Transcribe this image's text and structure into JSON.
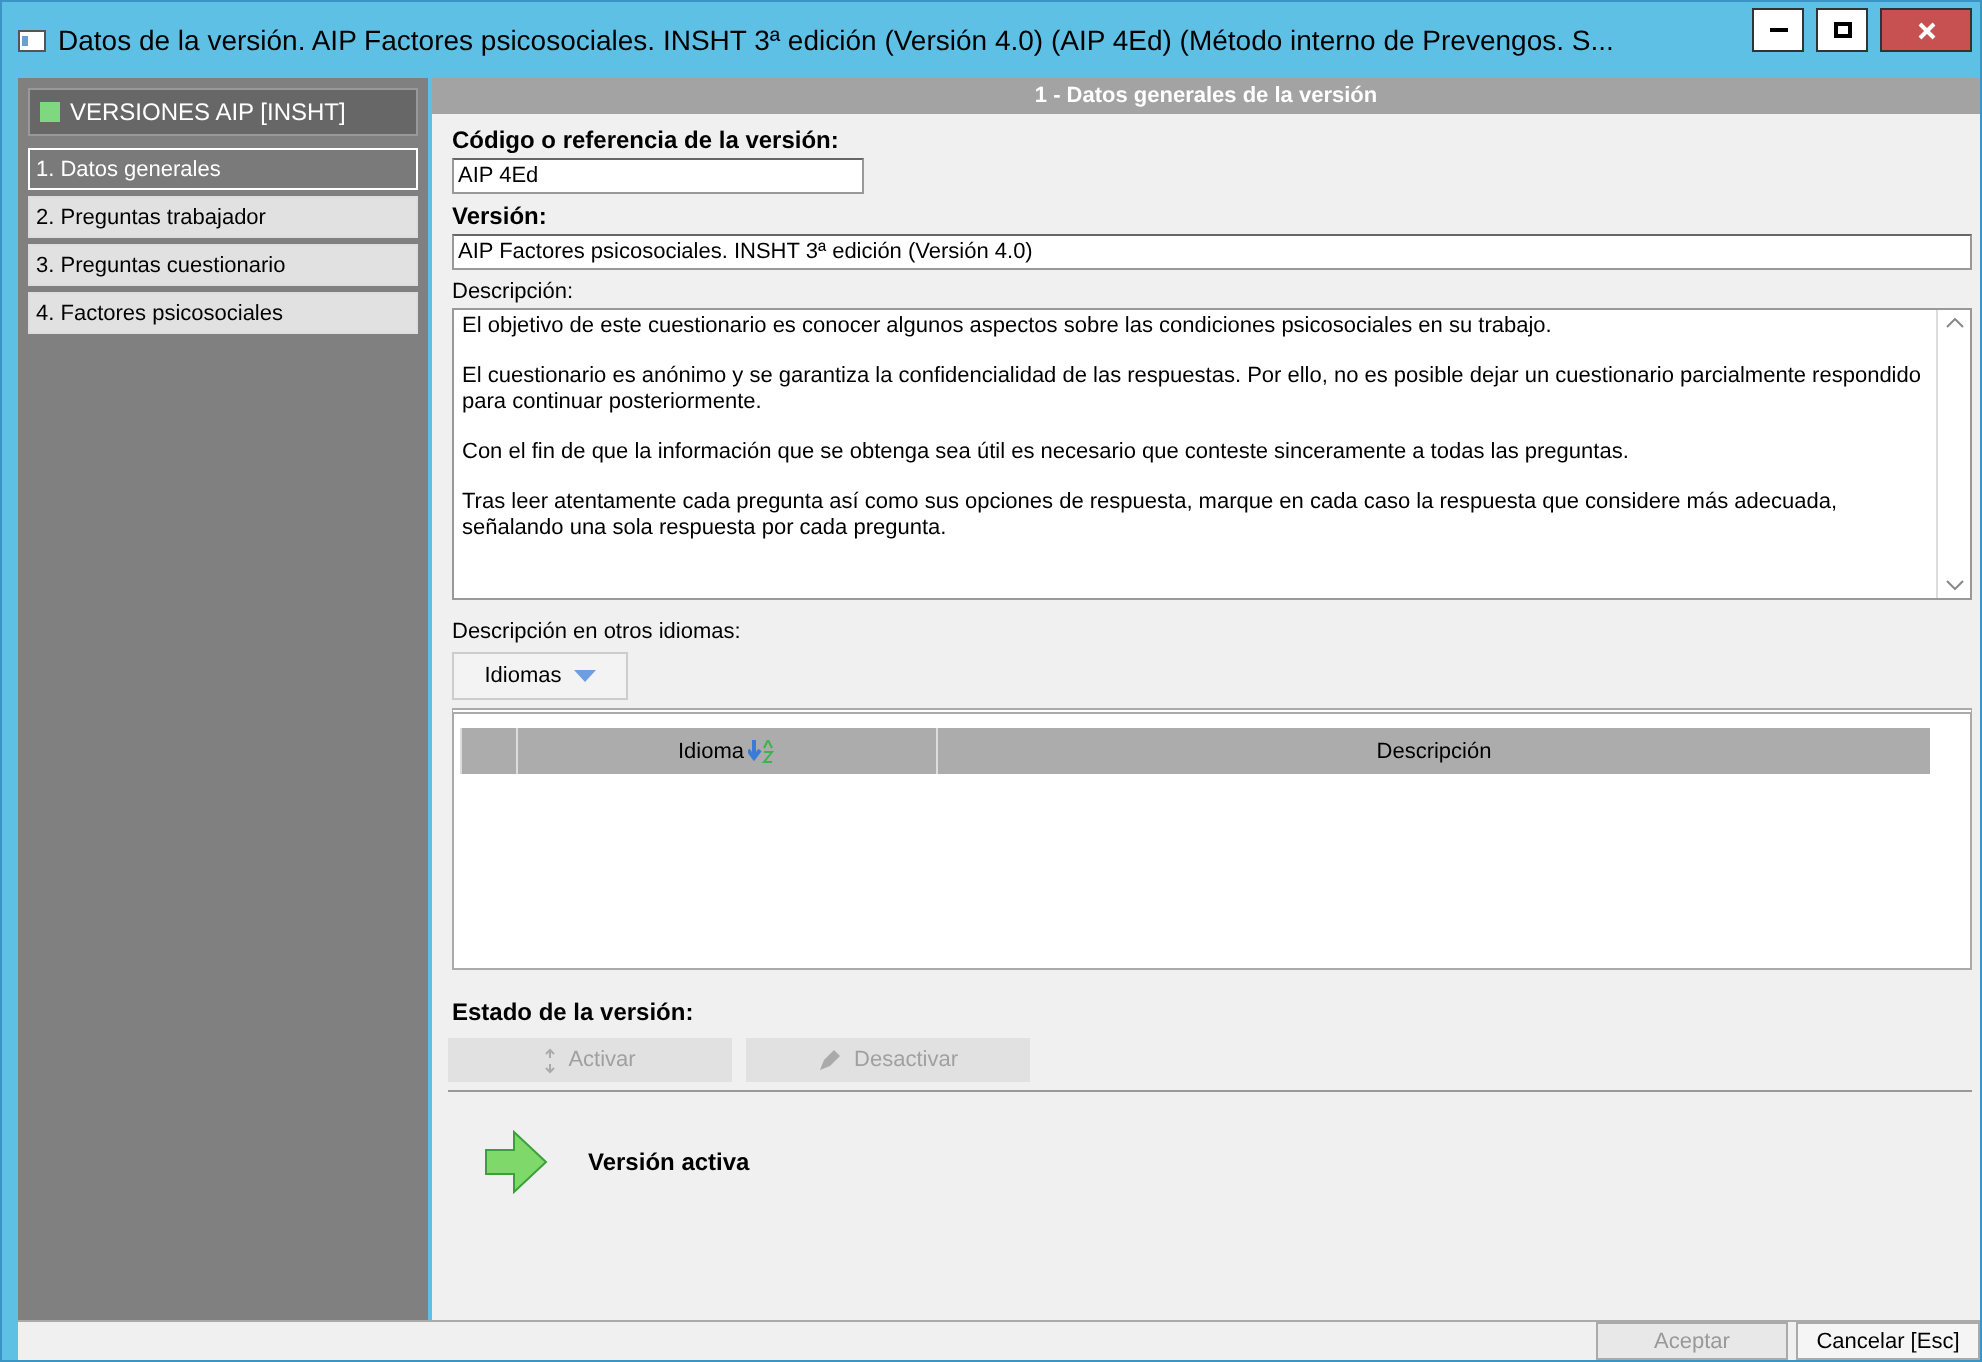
{
  "window": {
    "title": "Datos de la versión. AIP Factores psicosociales. INSHT 3ª edición (Versión 4.0) (AIP 4Ed)  (Método interno de Prevengos. S..."
  },
  "sidebar": {
    "header": "VERSIONES AIP [INSHT]",
    "items": [
      {
        "label": "1. Datos generales",
        "selected": true
      },
      {
        "label": "2. Preguntas trabajador",
        "selected": false
      },
      {
        "label": "3. Preguntas cuestionario",
        "selected": false
      },
      {
        "label": "4. Factores psicosociales",
        "selected": false
      }
    ]
  },
  "panel": {
    "title": "1 - Datos generales de la versión"
  },
  "form": {
    "code": {
      "label": "Código o referencia de la versión:",
      "value": "AIP 4Ed"
    },
    "version": {
      "label": "Versión:",
      "value": "AIP Factores psicosociales. INSHT 3ª edición (Versión 4.0)"
    },
    "description": {
      "label": "Descripción:",
      "paragraphs": [
        "El objetivo de este cuestionario es conocer algunos aspectos sobre las condiciones psicosociales en su trabajo.",
        "El cuestionario es anónimo y se garantiza la confidencialidad de las respuestas. Por ello, no es posible dejar un cuestionario parcialmente respondido para continuar posteriormente.",
        "Con el fin de que la información que se obtenga sea útil es necesario que conteste sinceramente a todas las preguntas.",
        "Tras leer atentamente cada pregunta así como sus opciones de respuesta, marque en cada caso la respuesta que considere más adecuada, señalando una sola respuesta por cada pregunta."
      ]
    }
  },
  "languages": {
    "label": "Descripción en otros idiomas:",
    "button": "Idiomas",
    "columns": [
      "Idioma",
      "Descripción"
    ]
  },
  "status": {
    "label": "Estado de la versión:",
    "buttons": [
      {
        "label": "Activar",
        "disabled": true
      },
      {
        "label": "Desactivar",
        "disabled": true
      }
    ],
    "state": "Versión activa"
  },
  "footer": {
    "buttons": [
      {
        "label": "Aceptar",
        "disabled": true
      },
      {
        "label": "Cancelar [Esc]",
        "disabled": false
      }
    ]
  }
}
